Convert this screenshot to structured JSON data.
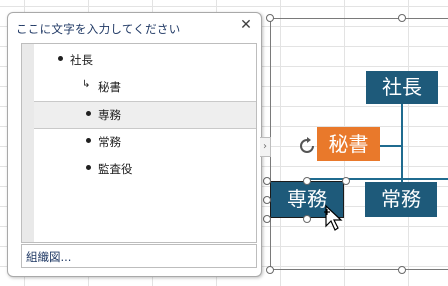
{
  "text_pane": {
    "title": "ここに文字を入力してください",
    "close_icon": "close-icon",
    "items": [
      {
        "label": "社長",
        "level": 1
      },
      {
        "label": "秘書",
        "level": 2,
        "bullet": "assistant-arrow"
      },
      {
        "label": "専務",
        "level": 2,
        "selected": true
      },
      {
        "label": "常務",
        "level": 2
      },
      {
        "label": "監査役",
        "level": 2
      }
    ],
    "footer_label": "組織図..."
  },
  "smartart": {
    "nodes": {
      "president": "社長",
      "secretary": "秘書",
      "senior_md": "専務",
      "managing_director": "常務"
    },
    "colors": {
      "teal": "#1e5a7a",
      "orange": "#e9792b",
      "connector": "#1f6b8f"
    }
  }
}
